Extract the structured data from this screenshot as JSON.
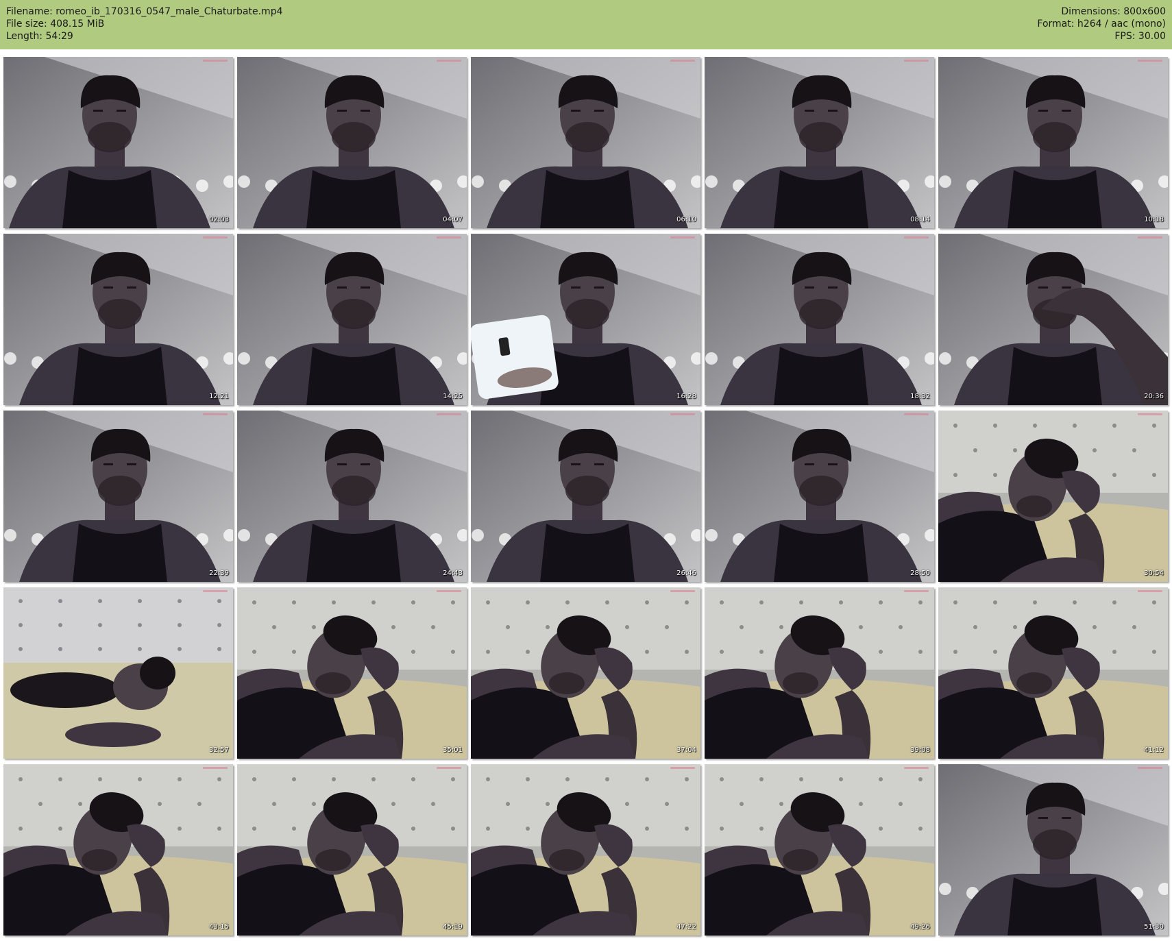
{
  "header": {
    "background": "#b0cb80",
    "filename": "Filename: romeo_ib_170316_0547_male_Chaturbate.mp4",
    "filesize": "File size: 408.15 MiB",
    "length": "Length: 54:29",
    "dimensions": "Dimensions: 800x600",
    "format": "Format: h264 / aac (mono)",
    "fps": "FPS: 30.00"
  },
  "thumbnails": [
    {
      "timestamp": "02:03",
      "scene": "wall"
    },
    {
      "timestamp": "04:07",
      "scene": "wall"
    },
    {
      "timestamp": "06:10",
      "scene": "wall"
    },
    {
      "timestamp": "08:14",
      "scene": "wall"
    },
    {
      "timestamp": "10:18",
      "scene": "wall"
    },
    {
      "timestamp": "12:21",
      "scene": "wall"
    },
    {
      "timestamp": "14:25",
      "scene": "wall"
    },
    {
      "timestamp": "16:28",
      "scene": "phone"
    },
    {
      "timestamp": "18:32",
      "scene": "wall"
    },
    {
      "timestamp": "20:36",
      "scene": "hand-head"
    },
    {
      "timestamp": "22:39",
      "scene": "wall"
    },
    {
      "timestamp": "24:43",
      "scene": "wall"
    },
    {
      "timestamp": "26:46",
      "scene": "wall"
    },
    {
      "timestamp": "28:50",
      "scene": "wall"
    },
    {
      "timestamp": "30:54",
      "scene": "bed"
    },
    {
      "timestamp": "32:57",
      "scene": "lying"
    },
    {
      "timestamp": "35:01",
      "scene": "bed"
    },
    {
      "timestamp": "37:04",
      "scene": "bed"
    },
    {
      "timestamp": "39:08",
      "scene": "bed"
    },
    {
      "timestamp": "41:12",
      "scene": "bed"
    },
    {
      "timestamp": "43:15",
      "scene": "bed"
    },
    {
      "timestamp": "45:19",
      "scene": "bed"
    },
    {
      "timestamp": "47:22",
      "scene": "bed"
    },
    {
      "timestamp": "49:26",
      "scene": "bed"
    },
    {
      "timestamp": "51:30",
      "scene": "wall"
    }
  ]
}
